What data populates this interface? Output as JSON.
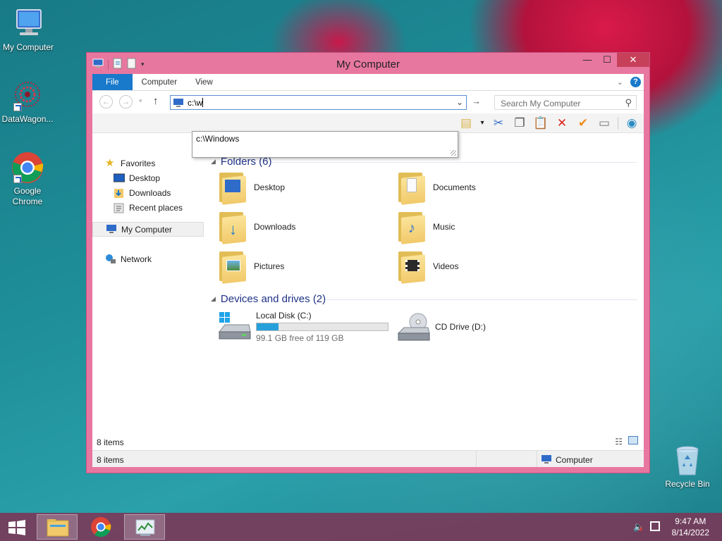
{
  "desktop": {
    "icons": [
      {
        "label": "My Computer"
      },
      {
        "label": "DataWagon..."
      },
      {
        "label": "Google Chrome"
      },
      {
        "label": "Recycle Bin"
      }
    ]
  },
  "window": {
    "title": "My Computer",
    "ribbon_tabs": [
      "File",
      "Computer",
      "View"
    ],
    "address_value": "c:\\w",
    "address_suggestion": "c:\\Windows",
    "search_placeholder": "Search My Computer",
    "nav": {
      "favorites": "Favorites",
      "desktop": "Desktop",
      "downloads": "Downloads",
      "recent_places": "Recent places",
      "my_computer": "My Computer",
      "network": "Network"
    },
    "folders_header": "Folders (6)",
    "folders": [
      "Desktop",
      "Documents",
      "Downloads",
      "Music",
      "Pictures",
      "Videos"
    ],
    "devices_header": "Devices and drives (2)",
    "drives": [
      {
        "name": "Local Disk (C:)",
        "free": "99.1 GB free of 119 GB",
        "used_fraction": 0.167
      },
      {
        "name": "CD Drive (D:)"
      }
    ],
    "status_items": "8 items",
    "details_items": "8 items",
    "details_location": "Computer"
  },
  "taskbar": {
    "time": "9:47 AM",
    "date": "8/14/2022"
  },
  "colors": {
    "accent": "#1979ca",
    "window_frame": "#e8779f",
    "close_button": "#c7405a",
    "taskbar": "#783a5a",
    "group_header": "#1e3287",
    "drive_bar": "#26a0da"
  }
}
